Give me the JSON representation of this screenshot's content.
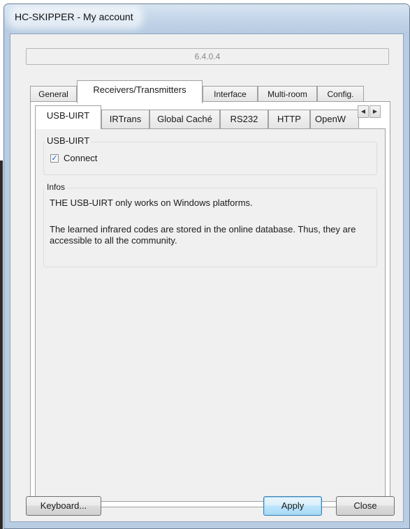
{
  "window": {
    "title": "HC-SKIPPER - My account"
  },
  "version": "6.4.0.4",
  "outer_tabs": [
    {
      "label": "General"
    },
    {
      "label": "Receivers/Transmitters",
      "selected": true
    },
    {
      "label": "Interface"
    },
    {
      "label": "Multi-room"
    },
    {
      "label": "Config."
    }
  ],
  "inner_tabs": [
    {
      "label": "USB-UIRT",
      "selected": true
    },
    {
      "label": "IRTrans"
    },
    {
      "label": "Global Caché"
    },
    {
      "label": "RS232"
    },
    {
      "label": "HTTP"
    },
    {
      "label": "OpenW"
    }
  ],
  "scroll": {
    "left_icon": "chevron-left-icon",
    "right_icon": "chevron-right-icon"
  },
  "usb_uirt_group": {
    "title": "USB-UIRT",
    "connect": {
      "label": "Connect",
      "checked": true
    }
  },
  "infos_group": {
    "title": "Infos",
    "line1": "THE USB-UIRT only works on Windows platforms.",
    "line2": "The learned infrared codes are stored in the online database. Thus, they are accessible to all the community."
  },
  "buttons": {
    "keyboard": "Keyboard...",
    "apply": "Apply",
    "close": "Close"
  }
}
